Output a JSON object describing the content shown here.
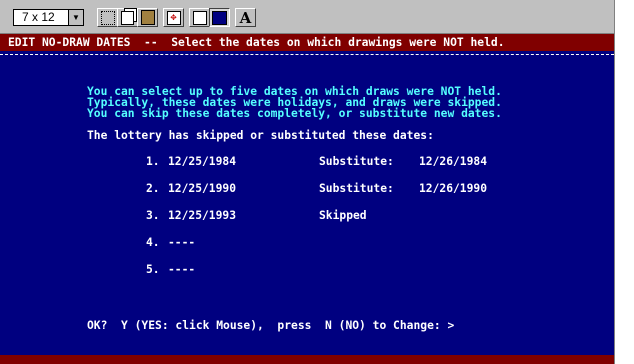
{
  "toolbar": {
    "font_size_value": "7 x 12",
    "buttons": [
      {
        "name": "mark-icon"
      },
      {
        "name": "copy-icon"
      },
      {
        "name": "paste-icon"
      },
      {
        "name": "full-screen-icon"
      },
      {
        "name": "properties-icon"
      },
      {
        "name": "background-icon"
      },
      {
        "name": "font-icon",
        "glyph": "A"
      }
    ]
  },
  "screen": {
    "title": "EDIT NO-DRAW DATES  --  Select the dates on which drawings were NOT held.",
    "intro": [
      "You can select up to five dates on which draws were NOT held.",
      "Typically, these dates were holidays, and draws were skipped.",
      "You can skip these dates completely, or substitute new dates."
    ],
    "heading": "The lottery has skipped or substituted these dates:",
    "entries": [
      {
        "num": "1.",
        "date": "12/25/1984",
        "status": "Substitute:",
        "sub_date": "12/26/1984"
      },
      {
        "num": "2.",
        "date": "12/25/1990",
        "status": "Substitute:",
        "sub_date": "12/26/1990"
      },
      {
        "num": "3.",
        "date": "12/25/1993",
        "status": "Skipped",
        "sub_date": ""
      },
      {
        "num": "4.",
        "date": "----",
        "status": "",
        "sub_date": ""
      },
      {
        "num": "5.",
        "date": "----",
        "status": "",
        "sub_date": ""
      }
    ],
    "prompt": "OK?  Y (YES: click Mouse),  press  N (NO) to Change: >"
  },
  "colors": {
    "background": "#000080",
    "title_bar": "#800000",
    "cyan_text": "#55ffff",
    "white_text": "#ffffff"
  }
}
